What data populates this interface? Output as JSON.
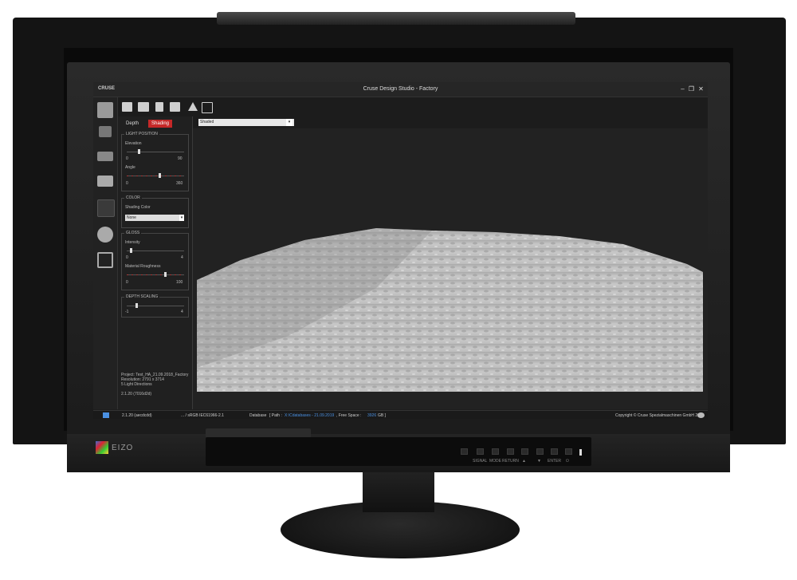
{
  "app": {
    "brand": "CRUSE",
    "title": "Cruse Design Studio - Factory",
    "window_controls": [
      "minimize-icon",
      "restore-icon",
      "close-icon"
    ]
  },
  "toolbar": {
    "icons": [
      "open-folder-icon",
      "import-icon",
      "save-icon",
      "export-icon",
      "triangle-icon",
      "exit-icon"
    ]
  },
  "rail": {
    "icons": [
      "home-icon",
      "grid-icon",
      "light-icon",
      "layers-icon",
      "texture-icon",
      "gear-icon",
      "logout-icon"
    ]
  },
  "panel": {
    "tabs": [
      "Depth",
      "Shading"
    ],
    "active_tab": "Shading",
    "light_position": {
      "label": "LIGHT POSITION",
      "elevation": {
        "label": "Elevation",
        "min": "0",
        "max": "90",
        "value_fraction": 0.2
      },
      "angle": {
        "label": "Angle",
        "min": "0",
        "max": "360",
        "value_fraction": 0.55
      }
    },
    "color": {
      "label": "COLOR",
      "shading_color_label": "Shading Color",
      "shading_color_value": "None"
    },
    "gloss": {
      "label": "GLOSS",
      "intensity": {
        "label": "Intensity",
        "min": "0",
        "max": "4",
        "value_fraction": 0.05
      },
      "roughness": {
        "label": "Material Roughness",
        "min": "0",
        "max": "100",
        "value_fraction": 0.65
      }
    },
    "depth_scaling": {
      "label": "DEPTH SCALING",
      "min": "-1",
      "max": "4",
      "value_fraction": 0.15
    },
    "info": {
      "project": "Project: Test_HA_21.09.2018_Factory",
      "resolution": "Resolution: 2791 x 3714",
      "lights": "5 Light Directions"
    },
    "version": "2.1.20 (7016d2d)"
  },
  "view": {
    "shading_mode": "Shaded"
  },
  "statusbar": {
    "version": "2.1.20 (aecdcdd)",
    "profile": "... / sRGB IEC61966-2.1",
    "database_label": "Database",
    "path_label": "[ Path :",
    "path_value": "X:\\Cdatabases - 21.09.2019",
    "free_space_label": ", Free Space :",
    "free_space_value": "3926",
    "free_space_unit": "GB ]",
    "copyright": "Copyright © Cruse Spezialmaschinen GmbH 2018"
  },
  "monitor": {
    "brand": "EIZO",
    "buttons": [
      "SIGNAL",
      "MODE",
      "RETURN",
      "▲",
      "▼",
      "ENTER",
      "⏻"
    ]
  },
  "colors": {
    "accent": "#c62828",
    "highlight_blue": "#4a90e2"
  }
}
